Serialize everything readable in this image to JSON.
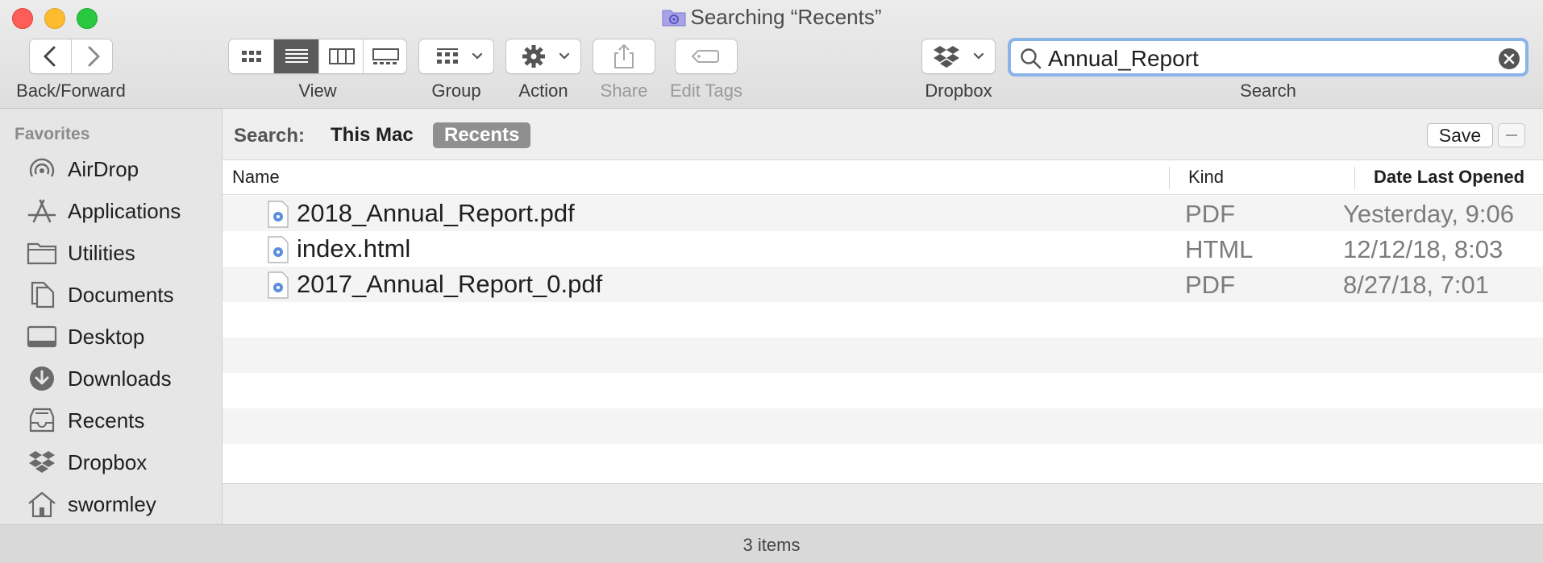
{
  "window": {
    "title": "Searching “Recents”"
  },
  "toolbar": {
    "back_forward_label": "Back/Forward",
    "view_label": "View",
    "group_label": "Group",
    "action_label": "Action",
    "share_label": "Share",
    "edit_tags_label": "Edit Tags",
    "dropbox_label": "Dropbox",
    "search_label": "Search",
    "view_modes": [
      "icon",
      "list",
      "column",
      "gallery"
    ],
    "active_view": "list"
  },
  "search": {
    "query": "Annual_Report"
  },
  "sidebar": {
    "header": "Favorites",
    "items": [
      {
        "label": "AirDrop",
        "icon": "airdrop-icon"
      },
      {
        "label": "Applications",
        "icon": "applications-icon"
      },
      {
        "label": "Utilities",
        "icon": "folder-icon"
      },
      {
        "label": "Documents",
        "icon": "documents-icon"
      },
      {
        "label": "Desktop",
        "icon": "desktop-icon"
      },
      {
        "label": "Downloads",
        "icon": "downloads-icon"
      },
      {
        "label": "Recents",
        "icon": "recents-icon"
      },
      {
        "label": "Dropbox",
        "icon": "dropbox-icon"
      },
      {
        "label": "swormley",
        "icon": "home-icon"
      }
    ]
  },
  "scope": {
    "label": "Search:",
    "options": [
      "This Mac",
      "Recents"
    ],
    "selected": "Recents",
    "save_label": "Save"
  },
  "columns": {
    "name": "Name",
    "kind": "Kind",
    "date": "Date Last Opened"
  },
  "files": [
    {
      "name": "2018_Annual_Report.pdf",
      "kind": "PDF",
      "date": "Yesterday, 9:06"
    },
    {
      "name": "index.html",
      "kind": "HTML",
      "date": "12/12/18, 8:03"
    },
    {
      "name": "2017_Annual_Report_0.pdf",
      "kind": "PDF",
      "date": "8/27/18, 7:01"
    }
  ],
  "status": {
    "text": "3 items"
  },
  "colors": {
    "accent": "#8ab3ea",
    "active_segment": "#5b5b5b",
    "selected_scope": "#8f8f8f"
  }
}
